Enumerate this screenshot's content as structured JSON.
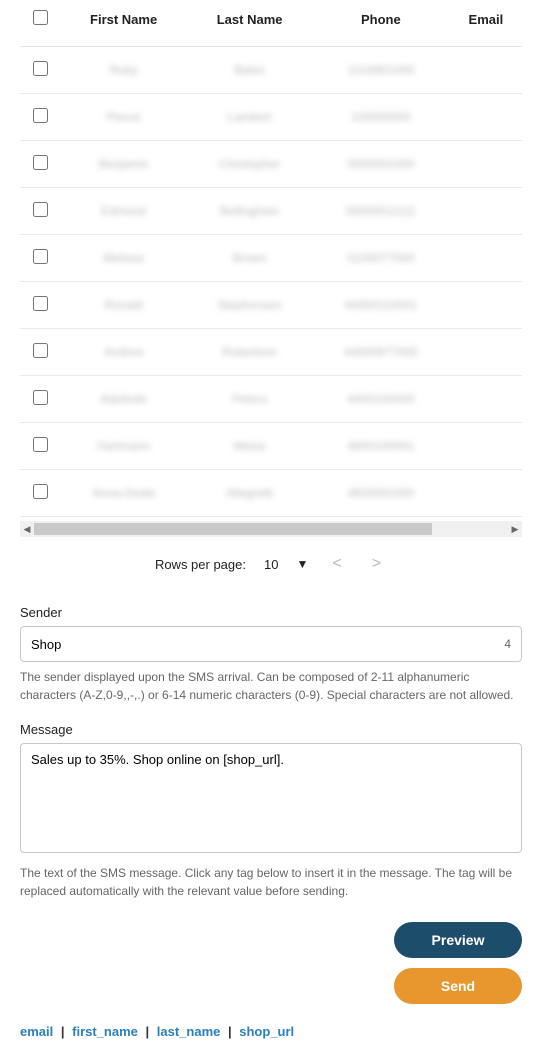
{
  "table": {
    "headers": {
      "first_name": "First Name",
      "last_name": "Last Name",
      "phone": "Phone",
      "email": "Email"
    },
    "rows": [
      {
        "first_name": "Ruby",
        "last_name": "Bates",
        "phone": "1019901000",
        "email": ""
      },
      {
        "first_name": "Pierce",
        "last_name": "Lambert",
        "phone": "100000000",
        "email": ""
      },
      {
        "first_name": "Benjamin",
        "last_name": "Christopher",
        "phone": "0000001000",
        "email": ""
      },
      {
        "first_name": "Edmond",
        "last_name": "Bellingham",
        "phone": "00000011111",
        "email": ""
      },
      {
        "first_name": "Melissa",
        "last_name": "Brown",
        "phone": "0100077000",
        "email": ""
      },
      {
        "first_name": "Ronald",
        "last_name": "Stephensen",
        "phone": "44000110001",
        "email": ""
      },
      {
        "first_name": "Andrea",
        "last_name": "Robertson",
        "phone": "44000977000",
        "email": ""
      },
      {
        "first_name": "Adelinde",
        "last_name": "Peters",
        "phone": "4400100000",
        "email": ""
      },
      {
        "first_name": "Hartmann",
        "last_name": "Weiss",
        "phone": "4600100001",
        "email": ""
      },
      {
        "first_name": "Anna-Giulia",
        "last_name": "Allegretti",
        "phone": "4600001000",
        "email": ""
      }
    ]
  },
  "pager": {
    "label": "Rows per page:",
    "value": "10"
  },
  "sender": {
    "label": "Sender",
    "value": "Shop",
    "count": "4",
    "help": "The sender displayed upon the SMS arrival. Can be composed of 2-11 alphanumeric characters (A-Z,0-9,,-,.) or 6-14 numeric characters (0-9). Special characters are not allowed."
  },
  "message": {
    "label": "Message",
    "value": "Sales up to 35%. Shop online on [shop_url].",
    "help": "The text of the SMS message. Click any tag below to insert it in the message. The tag will be replaced automatically with the relevant value before sending."
  },
  "buttons": {
    "preview": "Preview",
    "send": "Send"
  },
  "tags": {
    "email": "email",
    "first_name": "first_name",
    "last_name": "last_name",
    "shop_url": "shop_url"
  }
}
